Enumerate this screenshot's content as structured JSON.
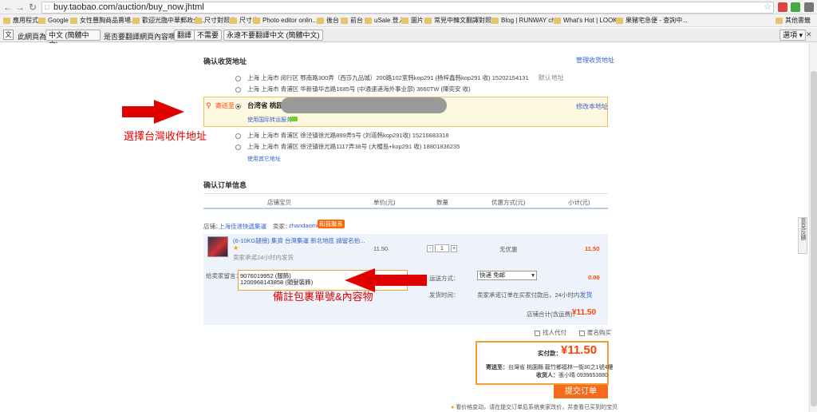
{
  "browser": {
    "url": "buy.taobao.com/auction/buy_now.jhtml",
    "bookmarks": [
      "應用程式",
      "Google",
      "女性豐胸商品賣場...",
      "歡迎光臨中華郵政全...",
      "尺寸對照表",
      "尺寸表",
      "Photo editor onlin...",
      "後台",
      "前台",
      "uSale 登入",
      "圖片",
      "常見中韓文翻譯對照...",
      "Blog | RUNWAY ch...",
      "What's Hot | LOOK...",
      "果豬宅急便 - 查詢中..."
    ],
    "other_bookmarks": "其他書籤"
  },
  "translate": {
    "prompt_prefix": "此網頁為",
    "language": "中文 (簡體中文)",
    "prompt_suffix": "是否要翻譯網頁內容嗎？",
    "translate_btn": "翻譯",
    "no_btn": "不需要",
    "never_btn": "永遠不要翻譯中文 (簡體中文)",
    "options_btn": "選項"
  },
  "address": {
    "title": "确认收货地址",
    "manage_link": "管理收货地址",
    "rows": [
      {
        "text": "上海 上海市 闵行区 鄂南路300弄（西莎九品城）200路102室韩kop291 (杨梓鑫韩kop291 收) 15202154131",
        "extra": "默认地址"
      },
      {
        "text": "上海 上海市 青浦区 华新镇华志路1685号 (中通速递海外事业部) 3660TW (陳奕安 收)"
      }
    ],
    "selected_label": "寄送至",
    "selected_text": "台湾省 桃园县",
    "modify_link": "修改本地址",
    "intl_link": "使用国际转运服务",
    "rows2": [
      {
        "text": "上海 上海市 青浦区 徐泾镇徐光路899弄5号 (刘道韩kop291收) 15216683318"
      },
      {
        "text": "上海 上海市 青浦区 徐泾镇徐光路1117弄38号 (大楣島+kop291 收) 18801836235"
      }
    ],
    "other_link": "使用其它地址"
  },
  "annotations": {
    "a1": "選擇台灣收件地址",
    "a2": "備註包裹單號&內容物"
  },
  "order": {
    "title": "确认订单信息",
    "headers": [
      "店铺宝贝",
      "单价(元)",
      "数量",
      "优惠方式(元)",
      "小计(元)"
    ],
    "shop_label": "店铺：",
    "shop_name": "上海佳達快遞集運",
    "seller_label": "卖家：",
    "seller_name": "zhandaomei",
    "contact": "和我聯系",
    "product_name": "(6-10KG鏈接) 集貨 台灣集運 新北地區 請留名拍...",
    "ship_note": "卖家承诺24小时内发货",
    "price": "11.50",
    "qty": "1",
    "discount": "无优惠",
    "subtotal": "11.50",
    "msg_label": "给卖家留言：",
    "msg_line1": "9076019952 (服飾)",
    "msg_line2": "1200968143858 (頭髮裝飾)",
    "shipping_label": "运送方式：",
    "shipping_value": "快递 免邮",
    "shipping_cost": "0.00",
    "send_label": "发货时间：",
    "send_text": "卖家承诺订单在买家付款后，24小时内",
    "send_link": "发货",
    "shop_total_label": "店铺合计(含运费)：",
    "shop_total": "¥11.50",
    "proxy_pay": "找人代付",
    "anonymous": "匿名购买"
  },
  "summary": {
    "pay_label": "实付款：",
    "pay_value": "¥11.50",
    "ship_to_label": "寄送至：",
    "ship_to": "台灣省 桃園縣 龍竹鄉福林一街30之1號4樓",
    "receiver_label": "收货人：",
    "receiver": "張小晴 0939653880",
    "submit": "提交订单",
    "tip": "看价格变动，请在提交订单后系统卖家改价，并查看已买到的宝贝"
  },
  "side_tab": "意見反饋",
  "colors": {
    "accent": "#f40",
    "arrow": "#e00000",
    "link": "#3366cc"
  }
}
